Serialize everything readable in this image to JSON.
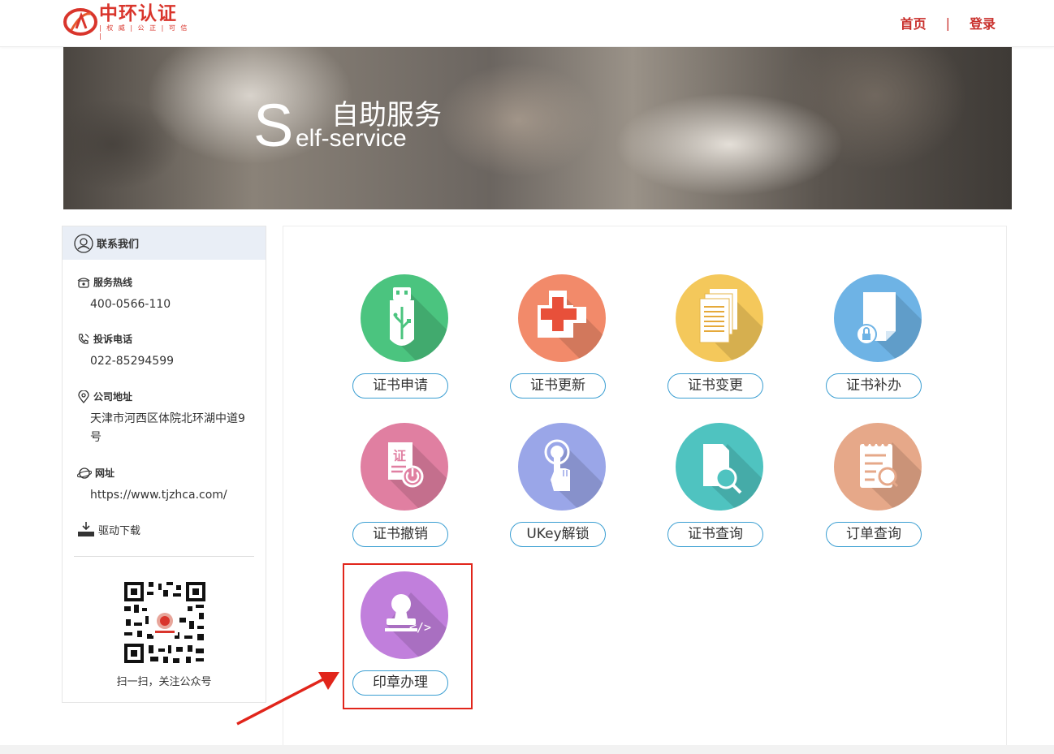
{
  "header": {
    "logo_name": "中环认证",
    "logo_slogan": "| 权 威 | 公 正 | 可 信 |",
    "nav": [
      {
        "label": "首页"
      },
      {
        "label": "登录"
      }
    ],
    "nav_separator": "|"
  },
  "banner": {
    "title_cn": "自助服务",
    "title_s": "S",
    "title_en_rest": "elf-service"
  },
  "sidebar": {
    "title": "联系我们",
    "hotline_label": "服务热线",
    "hotline_value": "400-0566-110",
    "complaint_label": "投诉电话",
    "complaint_value": "022-85294599",
    "address_label": "公司地址",
    "address_value": "天津市河西区体院北环湖中道9号",
    "website_label": "网址",
    "website_value": "https://www.tjzhca.com/",
    "driver_label": "驱动下载",
    "qr_caption": "扫一扫，关注公众号"
  },
  "services": [
    {
      "label": "证书申请",
      "color": "#4bc47f"
    },
    {
      "label": "证书更新",
      "color": "#f28a6a"
    },
    {
      "label": "证书变更",
      "color": "#f4c85b"
    },
    {
      "label": "证书补办",
      "color": "#6eb3e5"
    },
    {
      "label": "证书撤销",
      "color": "#e07fa1"
    },
    {
      "label": "UKey解锁",
      "color": "#9aa6e8"
    },
    {
      "label": "证书查询",
      "color": "#4fc3c0"
    },
    {
      "label": "订单查询",
      "color": "#e6a889"
    },
    {
      "label": "印章办理",
      "color": "#c17fdc"
    }
  ],
  "colors": {
    "brand_red": "#d9352c",
    "button_border": "#3a9ed2",
    "highlight": "#e1251b"
  }
}
